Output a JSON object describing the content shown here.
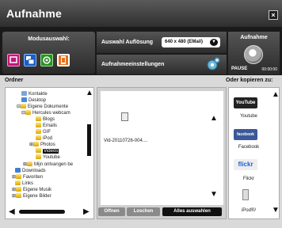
{
  "window": {
    "title": "Aufnahme",
    "close_label": "×"
  },
  "mode": {
    "label": "Modusauswahl:"
  },
  "resolution": {
    "label": "Auswahl Auflösung",
    "selected": "640 x 480 (EMail)"
  },
  "settings": {
    "label": "Aufnahmeeinstellungen"
  },
  "record": {
    "label": "Aufnahme",
    "state": "PAUSE",
    "time": "00:00:00"
  },
  "folder_section": {
    "label": "Ordner"
  },
  "copy_section": {
    "label": "Oder kopieren zu:"
  },
  "tree": [
    {
      "label": "Kontakte",
      "level": 1
    },
    {
      "label": "Desktop",
      "level": 1
    },
    {
      "label": "Eigene Dokumente",
      "level": 1
    },
    {
      "label": "Hercules webcam",
      "level": 2
    },
    {
      "label": "Blogs",
      "level": 3
    },
    {
      "label": "Emails",
      "level": 3
    },
    {
      "label": "GIF",
      "level": 3
    },
    {
      "label": "iPod",
      "level": 3
    },
    {
      "label": "Photos",
      "level": 3
    },
    {
      "label": "Videos",
      "level": 3,
      "selected": true
    },
    {
      "label": "Youtube",
      "level": 3
    },
    {
      "label": "Mijn ontvangen be",
      "level": 2
    },
    {
      "label": "Downloads",
      "level": 1
    },
    {
      "label": "Favoriten",
      "level": 1
    },
    {
      "label": "Links",
      "level": 1
    },
    {
      "label": "Eigene Musik",
      "level": 1
    },
    {
      "label": "Eigene Bilder",
      "level": 1
    }
  ],
  "files": {
    "items": [
      {
        "name": "Vid-20110726-004...."
      }
    ]
  },
  "actions": {
    "open": "Offnen",
    "delete": "Loschen",
    "select_all": "Alles auswahlen"
  },
  "destinations": [
    {
      "label": "Youtube",
      "logo": "YouTube"
    },
    {
      "label": "Facebook",
      "logo": "facebook"
    },
    {
      "label": "Flickr",
      "logo": "flickr"
    },
    {
      "label": "iPod®/",
      "logo": "ipod-icon"
    }
  ],
  "colors": {
    "accent_orange": "#e8711c",
    "mode_pink": "#c2187a",
    "mode_blue": "#1a5fc8",
    "mode_green": "#2f8f2a"
  }
}
